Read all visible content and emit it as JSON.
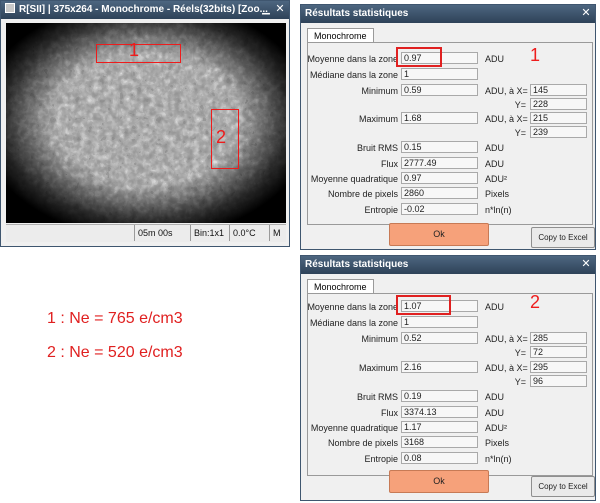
{
  "image_window": {
    "title": "R[SII] | 375x264 - Monochrome - Réels(32bits)   [Zoo...",
    "zone1_label": "1",
    "zone2_label": "2",
    "status": {
      "time": "05m 00s",
      "bin": "Bin:1x1",
      "temp": "0.0°C",
      "extra": "M"
    }
  },
  "result1": {
    "title": "Résultats statistiques",
    "tab": "Monochrome",
    "labels": {
      "mean": "Moyenne dans la zone",
      "median": "Médiane dans la zone",
      "min": "Minimum",
      "max": "Maximum",
      "noise": "Bruit RMS",
      "flux": "Flux",
      "rms": "Moyenne quadratique",
      "npix": "Nombre de pixels",
      "entropy": "Entropie"
    },
    "values": {
      "mean": "0.97",
      "median": "1",
      "min": "0.59",
      "min_x": "145",
      "min_y": "228",
      "max": "1.68",
      "max_x": "215",
      "max_y": "239",
      "noise": "0.15",
      "flux": "2777.49",
      "rms": "0.97",
      "npix": "2860",
      "entropy": "-0.02"
    },
    "units": {
      "adu": "ADU",
      "adu_x": "ADU, à X=",
      "y": "Y=",
      "adu2": "ADU²",
      "pixels": "Pixels",
      "entropy_unit": "n*ln(n)"
    },
    "badge": "1",
    "ok_label": "Ok",
    "excel_label": "Copy to Excel"
  },
  "result2": {
    "title": "Résultats statistiques",
    "tab": "Monochrome",
    "labels": {
      "mean": "Moyenne dans la zone",
      "median": "Médiane dans la zone",
      "min": "Minimum",
      "max": "Maximum",
      "noise": "Bruit RMS",
      "flux": "Flux",
      "rms": "Moyenne quadratique",
      "npix": "Nombre de pixels",
      "entropy": "Entropie"
    },
    "values": {
      "mean": "1.07",
      "median": "1",
      "min": "0.52",
      "min_x": "285",
      "min_y": "72",
      "max": "2.16",
      "max_x": "295",
      "max_y": "96",
      "noise": "0.19",
      "flux": "3374.13",
      "rms": "1.17",
      "npix": "3168",
      "entropy": "0.08"
    },
    "units": {
      "adu": "ADU",
      "adu_x": "ADU, à X=",
      "y": "Y=",
      "adu2": "ADU²",
      "pixels": "Pixels",
      "entropy_unit": "n*ln(n)"
    },
    "badge": "2",
    "ok_label": "Ok",
    "excel_label": "Copy to Excel"
  },
  "annotations": {
    "line1": "1 : Ne = 765 e/cm3",
    "line2": "2 : Ne = 520 e/cm3"
  },
  "colors": {
    "annotation": "#e02020",
    "titlebar": "#3b536c",
    "ok_button": "#f6a17a"
  }
}
